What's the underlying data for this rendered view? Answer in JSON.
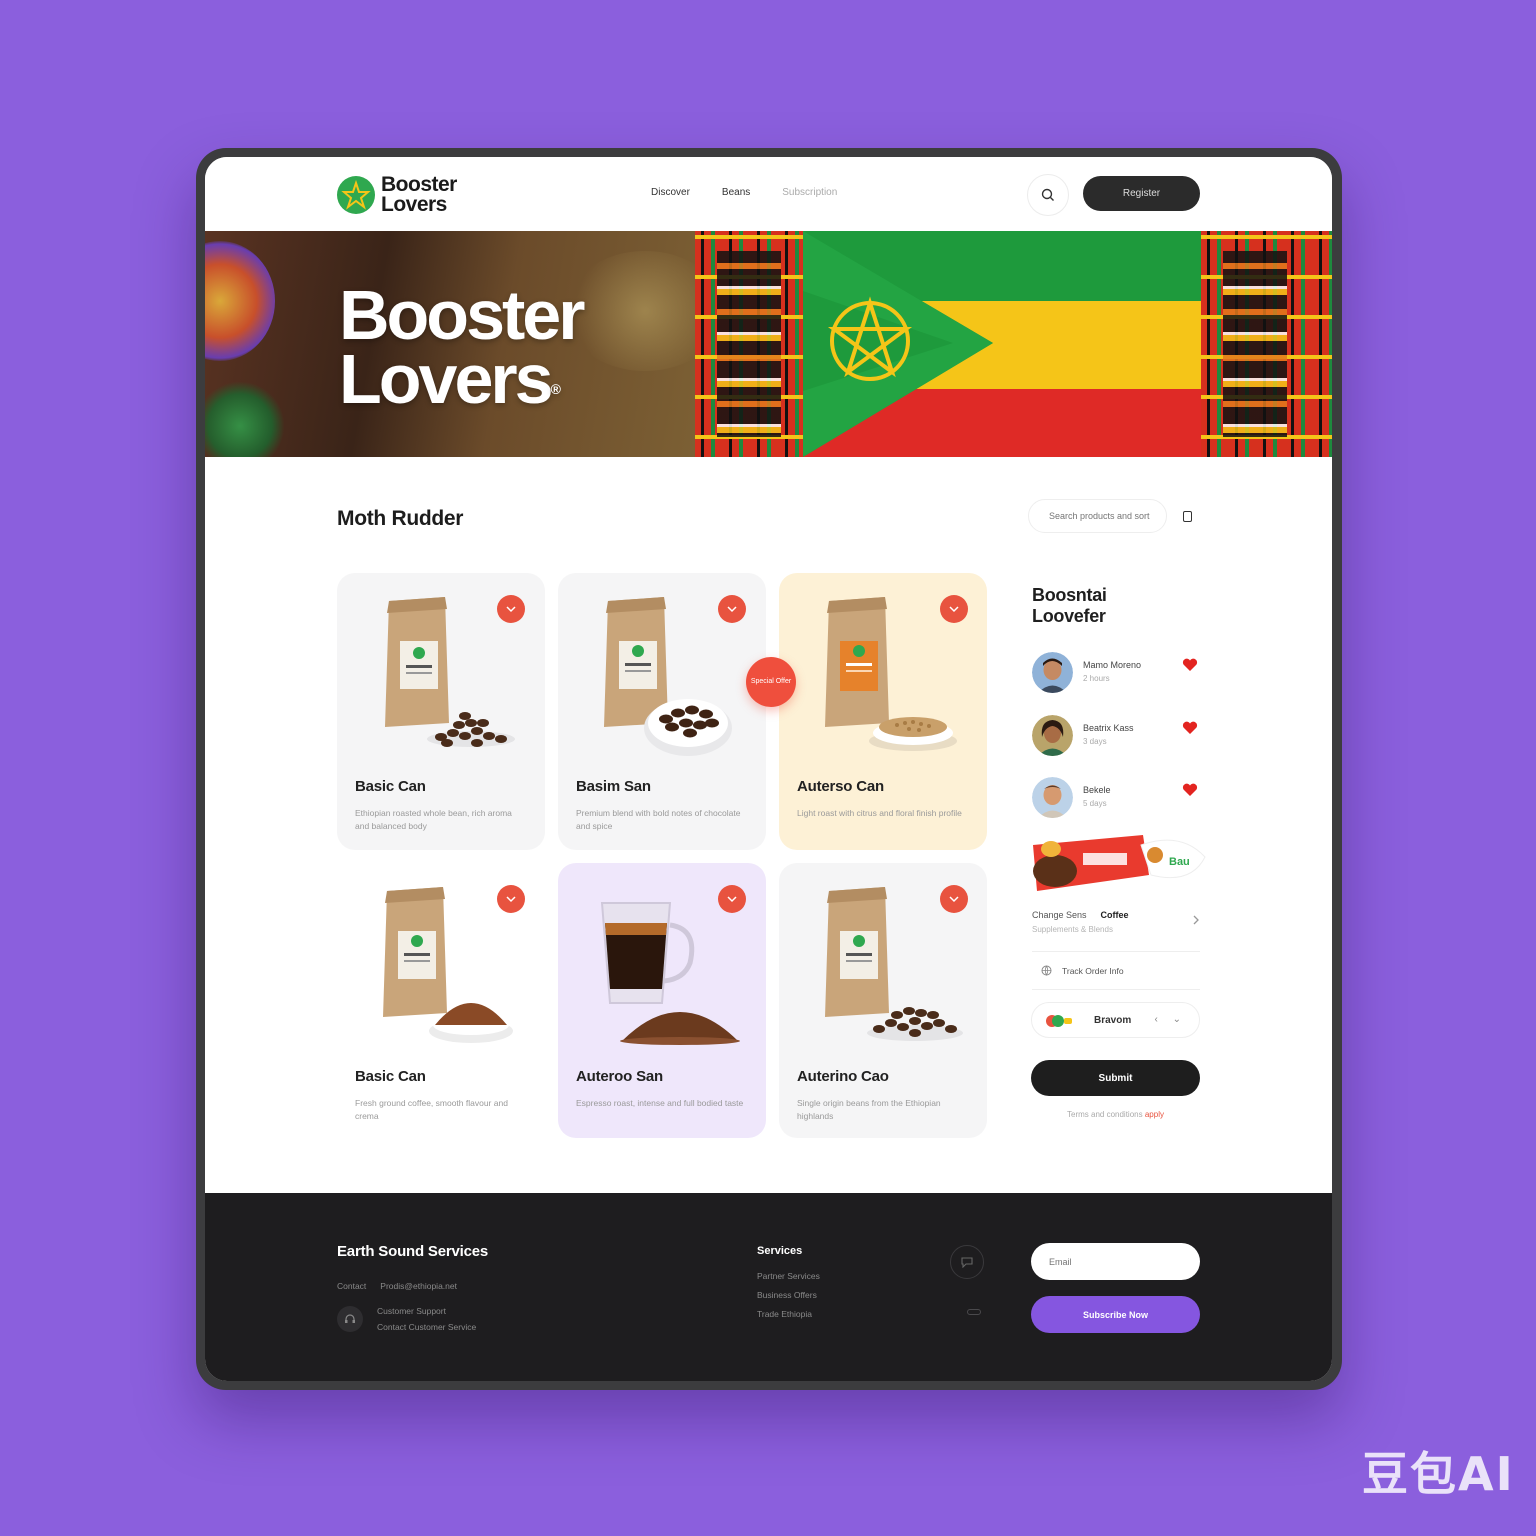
{
  "header": {
    "logo_line1": "Booster",
    "logo_line2": "Lovers",
    "nav": [
      "Discover",
      "Beans",
      "Subscription"
    ],
    "cta_label": "Register"
  },
  "hero": {
    "title_line1": "Booster",
    "title_line2": "Lovers",
    "title_mark": "®"
  },
  "section": {
    "title": "Moth Rudder",
    "filter_placeholder": "Search products and sort"
  },
  "products": [
    {
      "name": "Basic Can",
      "desc": "Ethiopian roasted whole bean, rich aroma and balanced body"
    },
    {
      "name": "Basim San",
      "desc": "Premium blend with bold notes of chocolate and spice"
    },
    {
      "name": "Auterso Can",
      "desc": "Light roast with citrus and floral finish profile"
    },
    {
      "name": "Basic Can",
      "desc": "Fresh ground coffee, smooth flavour and crema"
    },
    {
      "name": "Auteroo San",
      "desc": "Espresso roast, intense and full bodied taste"
    },
    {
      "name": "Auterino Cao",
      "desc": "Single origin beans from the Ethiopian highlands"
    }
  ],
  "sale_badge": "Special Offer",
  "sidebar": {
    "title_line1": "Boosntai",
    "title_line2": "Loovefer",
    "people": [
      {
        "name": "Mamo Moreno",
        "meta": "2 hours"
      },
      {
        "name": "Beatrix Kass",
        "meta": "3 days"
      },
      {
        "name": "Bekele",
        "meta": "5 days"
      }
    ],
    "promo_title": "Change Sens",
    "promo_title_bold": "Coffee",
    "promo_sub": "Supplements & Blends",
    "track_label": "Track Order Info",
    "select_label": "Bravom",
    "submit_label": "Submit",
    "fine_print": "Terms and conditions ",
    "fine_print_link": "apply"
  },
  "footer": {
    "title": "Earth Sound Services",
    "line_a": "Contact",
    "line_b": "Prodis@ethiopia.net",
    "support_line1": "Customer Support",
    "support_line2": "Contact Customer Service",
    "col_title": "Services",
    "links": [
      "Partner Services",
      "Business Offers",
      "Trade Ethiopia"
    ],
    "email_placeholder": "Email",
    "subscribe_label": "Subscribe Now"
  },
  "watermark": "豆包AI",
  "colors": {
    "background": "#8b5fdd",
    "accent_red": "#e8533f",
    "dark": "#1e1d1f",
    "green": "#2fa84f",
    "yellow": "#f5c518"
  }
}
